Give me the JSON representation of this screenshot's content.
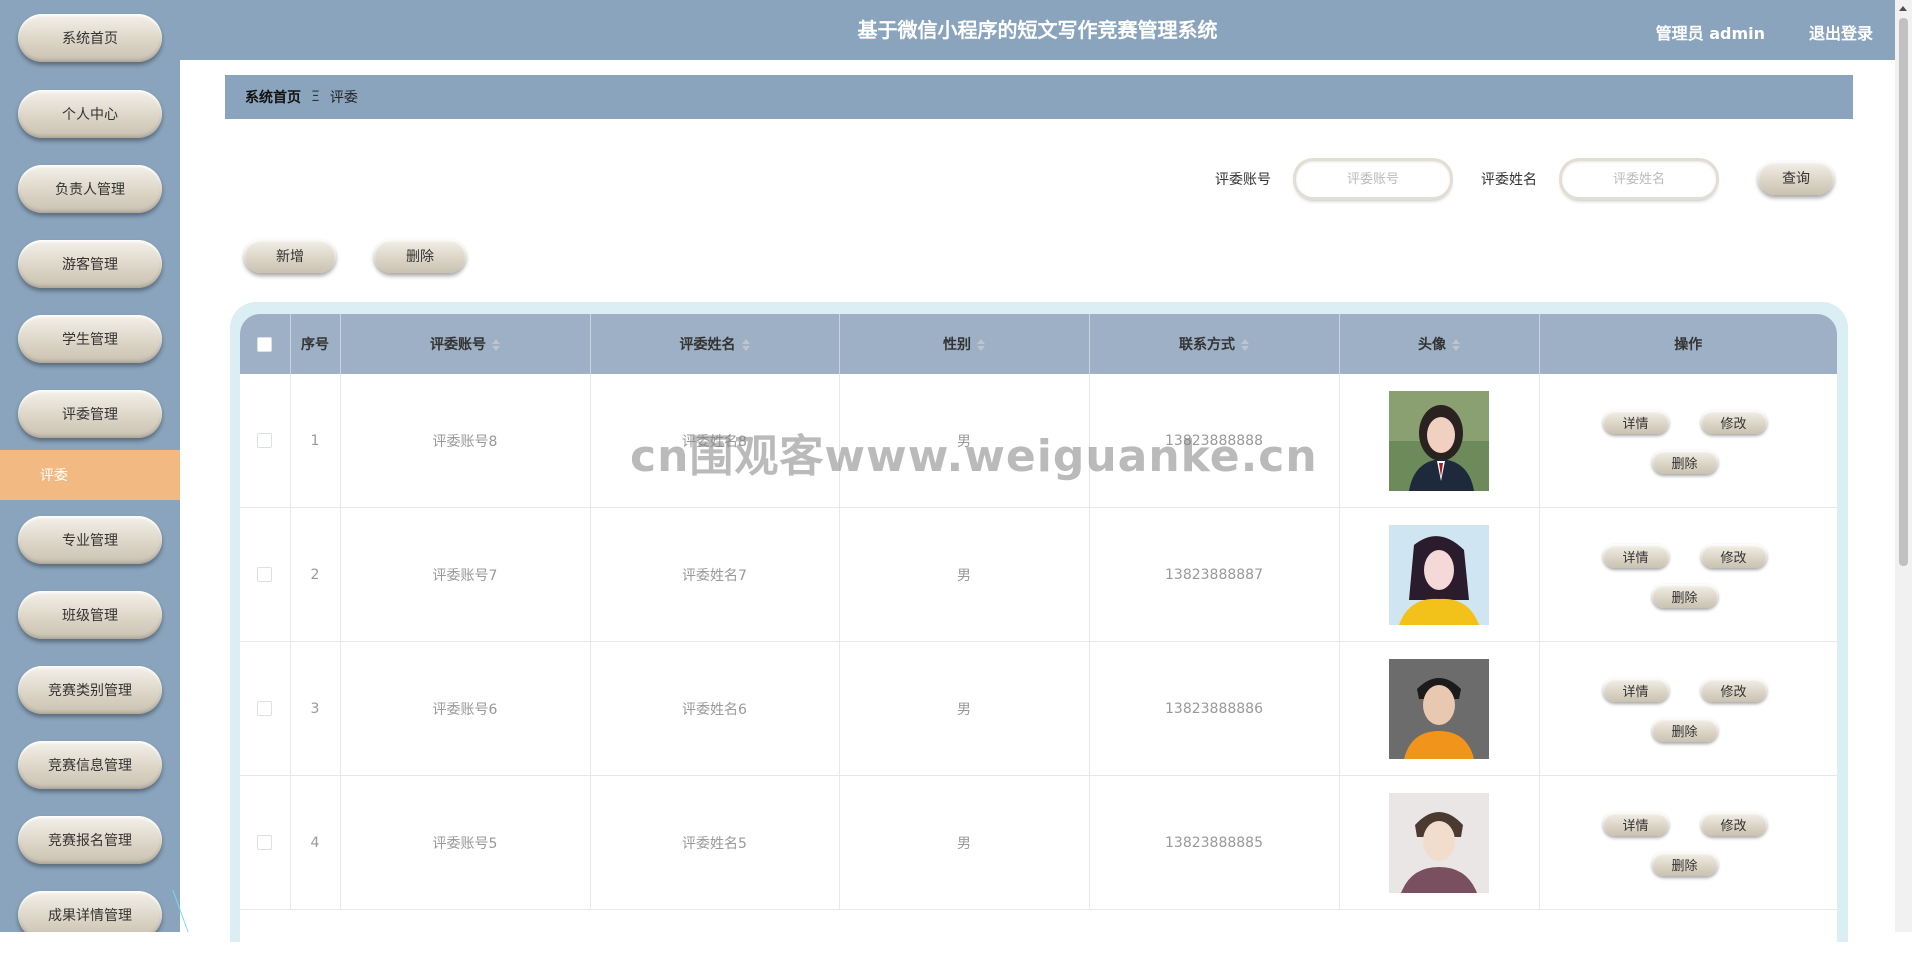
{
  "header": {
    "title": "基于微信小程序的短文写作竞赛管理系统",
    "user": "管理员 admin",
    "logout": "退出登录"
  },
  "sidebar": {
    "items": [
      {
        "label": "系统首页"
      },
      {
        "label": "个人中心"
      },
      {
        "label": "负责人管理"
      },
      {
        "label": "游客管理"
      },
      {
        "label": "学生管理"
      },
      {
        "label": "评委管理"
      },
      {
        "label": "专业管理"
      },
      {
        "label": "班级管理"
      },
      {
        "label": "竞赛类别管理"
      },
      {
        "label": "竞赛信息管理"
      },
      {
        "label": "竞赛报名管理"
      },
      {
        "label": "成果详情管理"
      }
    ],
    "active_sub": "评委"
  },
  "breadcrumb": {
    "home": "系统首页",
    "separator": "Ξ",
    "current": "评委"
  },
  "search": {
    "account_label": "评委账号",
    "account_placeholder": "评委账号",
    "name_label": "评委姓名",
    "name_placeholder": "评委姓名",
    "query_button": "查询"
  },
  "toolbar": {
    "add_label": "新增",
    "delete_label": "删除"
  },
  "table": {
    "columns": [
      "序号",
      "评委账号",
      "评委姓名",
      "性别",
      "联系方式",
      "头像",
      "操作"
    ],
    "rows": [
      {
        "index": "1",
        "account": "评委账号8",
        "name": "评委姓名8",
        "gender": "男",
        "phone": "13823888888"
      },
      {
        "index": "2",
        "account": "评委账号7",
        "name": "评委姓名7",
        "gender": "男",
        "phone": "13823888887"
      },
      {
        "index": "3",
        "account": "评委账号6",
        "name": "评委姓名6",
        "gender": "男",
        "phone": "13823888886"
      },
      {
        "index": "4",
        "account": "评委账号5",
        "name": "评委姓名5",
        "gender": "男",
        "phone": "13823888885"
      }
    ],
    "actions": {
      "detail": "详情",
      "edit": "修改",
      "delete": "删除"
    }
  },
  "watermark": "cn围观客www.weiguanke.cn",
  "colors": {
    "sidebar_bg": "#8aa4bd",
    "active_item": "#f2b983",
    "table_header": "#9db0c5"
  }
}
